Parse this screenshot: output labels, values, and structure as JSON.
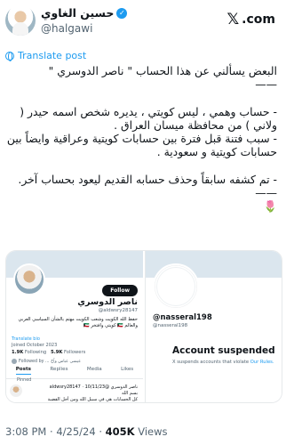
{
  "author": {
    "display_name": "حسين الغاوي",
    "handle": "@halgawi",
    "verified_icon": "verified-badge-icon"
  },
  "brand": {
    "logo_icon": "x-logo-icon",
    "site": ".com"
  },
  "translate_label": "Translate post",
  "tweet_text": "البعض يسألني عن هذا الحساب \" ناصر الدوسري \"\n——\n\n- حساب وهمي ، ليس كويتي ، يديره شخص اسمه حيدر ( ولاني ) من محافظة ميسان العراق .\n- سبب فتنة قبل فترة بين حسابات كويتية وعراقية وايضاً بين حسابات كويتية و سعودية .\n\n- تم كشفه سابقاً وحذف حسابه القديم ليعود بحساب آخر.\n——\n🌷",
  "left_screenshot": {
    "follow_label": "Follow",
    "name": "ناصر الدوسري",
    "handle": "@aldwsry28147",
    "bio": "حفظ الله الكويت وشعب الكويت مهتم بالشأن السياسي العربي\nوالعالم 🇰🇼 كويتي وافتخر 🇰🇼",
    "translate_bio": "Translate bio",
    "joined": "Joined October 2023",
    "following_count": "1.9K",
    "following_label": "Following",
    "followers_count": "5.9K",
    "followers_label": "Followers",
    "followed_by": "Followed by ... عيسى عباس وآخ",
    "tabs": [
      "Posts",
      "Replies",
      "Media",
      "Likes"
    ],
    "pinned_label": "Pinned",
    "pinned_post_header": "ناصر الدوسري @aldwsry28147 · 10/11/23",
    "pinned_post_text": "بسم الله\nكل الحسابات هي في سبيل الله ومن أجل القضية\nالفلسطينية"
  },
  "right_screenshot": {
    "name": "@nasseral198",
    "handle": "@nasseral198",
    "suspended_title": "Account suspended",
    "suspended_desc": "X suspends accounts that violate",
    "suspended_link": "Our Rules."
  },
  "meta": {
    "time": "3:08 PM",
    "date": "4/25/24",
    "views_count": "405K",
    "views_label": "Views"
  }
}
